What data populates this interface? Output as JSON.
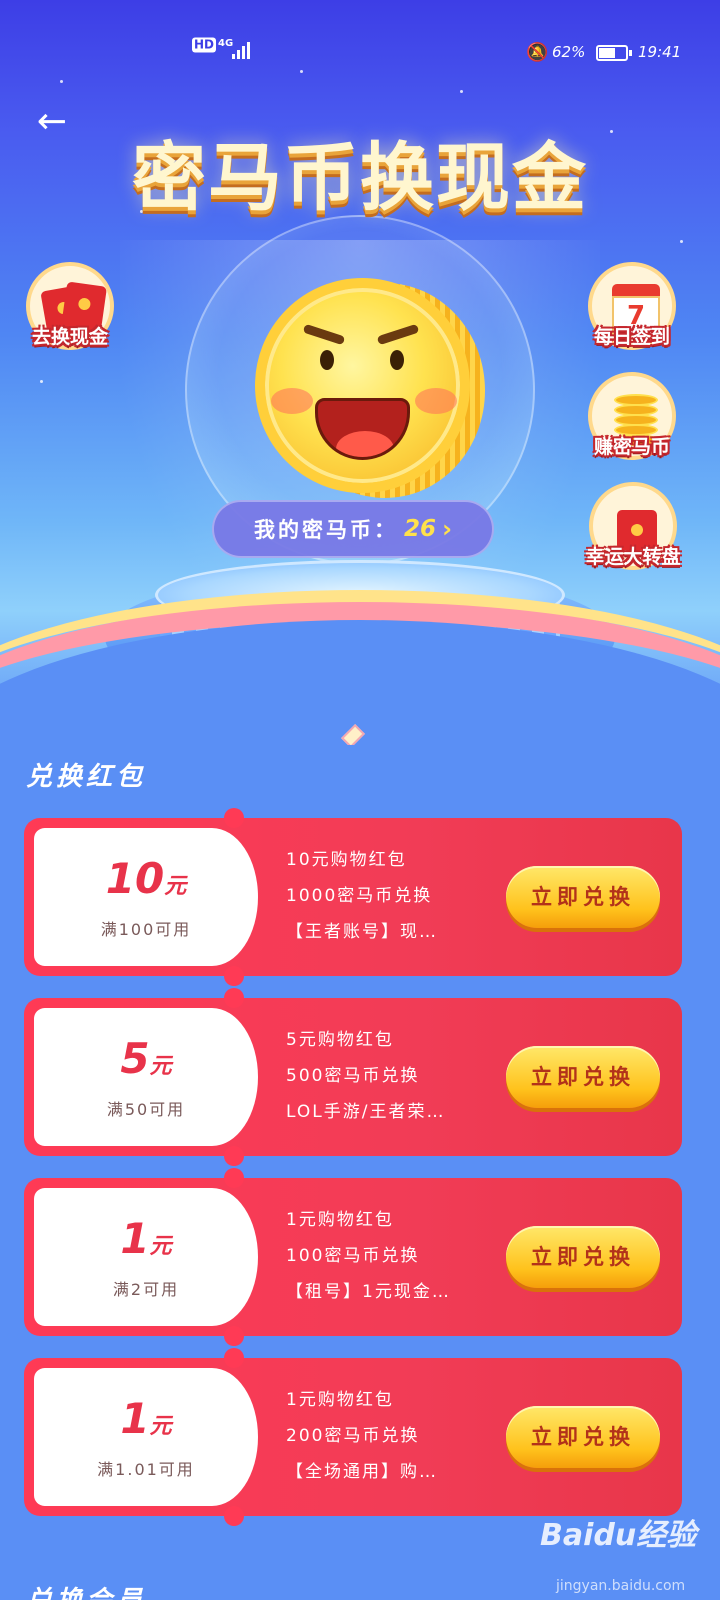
{
  "status_bar": {
    "hd": "HD",
    "network": "4G",
    "battery_percent": "62%",
    "battery_level": 0.62,
    "time": "19:41"
  },
  "header": {
    "title": "密马币换现金"
  },
  "side_entries": {
    "cash": "去换现金",
    "signin": "每日签到",
    "signin_day": "7",
    "earn": "赚密马币",
    "wheel": "幸运大转盘"
  },
  "balance": {
    "label": "我的密马币：",
    "value": "26",
    "chevron": "›"
  },
  "section": {
    "title": "兑换红包",
    "next_title": "兑换会员"
  },
  "vouchers": [
    {
      "amount": "10",
      "unit": "元",
      "condition": "满100可用",
      "line1": "10元购物红包",
      "line2": "1000密马币兑换",
      "line3": "【王者账号】现…",
      "button": "立即兑换"
    },
    {
      "amount": "5",
      "unit": "元",
      "condition": "满50可用",
      "line1": "5元购物红包",
      "line2": "500密马币兑换",
      "line3": "LOL手游/王者荣…",
      "button": "立即兑换"
    },
    {
      "amount": "1",
      "unit": "元",
      "condition": "满2可用",
      "line1": "1元购物红包",
      "line2": "100密马币兑换",
      "line3": "【租号】1元现金…",
      "button": "立即兑换"
    },
    {
      "amount": "1",
      "unit": "元",
      "condition": "满1.01可用",
      "line1": "1元购物红包",
      "line2": "200密马币兑换",
      "line3": "【全场通用】购…",
      "button": "立即兑换"
    }
  ],
  "watermark": {
    "brand": "Baidu经验",
    "url": "jingyan.baidu.com"
  },
  "colors": {
    "accent_red": "#ff3a55",
    "button_yellow": "#ffc21c",
    "page_blue": "#5a8ff5"
  }
}
